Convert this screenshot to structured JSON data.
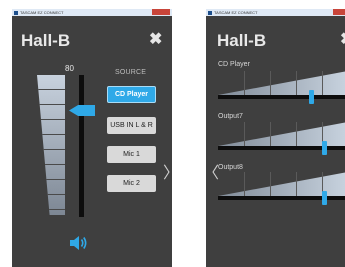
{
  "left_window": {
    "titlebar_text": "TASCAM EZ CONNECT",
    "title": "Hall-B",
    "close_glyph": "✖",
    "level_value": "80",
    "source_header": "SOURCE",
    "sources": [
      {
        "label": "CD Player",
        "active": true
      },
      {
        "label": "USB IN L & R",
        "active": false
      },
      {
        "label": "Mic 1",
        "active": false
      },
      {
        "label": "Mic 2",
        "active": false
      }
    ],
    "volume_fraction": 0.66,
    "speaker_icon": "speaker-icon",
    "next_glyph": "〉"
  },
  "right_window": {
    "titlebar_text": "TASCAM EZ CONNECT",
    "title": "Hall-B",
    "close_glyph": "✖",
    "prev_glyph": "〈",
    "channels": [
      {
        "label": "CD Player",
        "level": 0.72
      },
      {
        "label": "Output7",
        "level": 0.82
      },
      {
        "label": "Output8",
        "level": 0.82
      }
    ]
  },
  "colors": {
    "accent": "#2fa9e8",
    "panel": "#3f3f3f",
    "button": "#d9d9d9",
    "titlebar": "#dfe9f5"
  }
}
